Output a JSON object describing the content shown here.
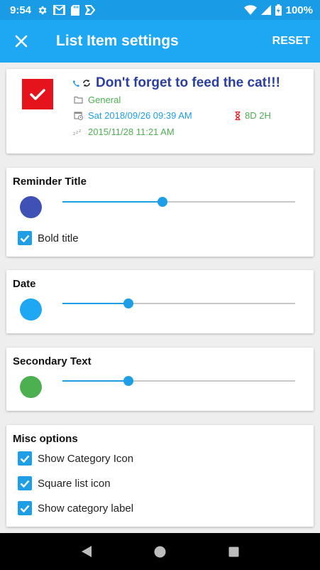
{
  "status_bar": {
    "time": "9:54",
    "battery": "100%",
    "icons": [
      "gear-icon",
      "gmail-icon",
      "sd-card-icon",
      "app-notification-icon",
      "wifi-icon",
      "signal-icon",
      "battery-charging-icon"
    ]
  },
  "app_bar": {
    "title": "List Item settings",
    "reset_label": "RESET"
  },
  "preview": {
    "title": "Don't forget to feed the cat!!!",
    "category": "General",
    "due_date": "Sat 2018/09/26 09:39 AM",
    "countdown": "8D 2H",
    "created": "2015/11/28 11:21 AM",
    "colors": {
      "icon_bg": "#e5131b",
      "title": "#2a3fa0",
      "date": "#1e9ee6",
      "secondary": "#4caf50"
    }
  },
  "reminder_title": {
    "label": "Reminder Title",
    "color": "#3f51b5",
    "slider_value": 0.43,
    "bold_label": "Bold title",
    "bold_checked": true
  },
  "date": {
    "label": "Date",
    "color": "#1ea7f3",
    "slider_value": 0.285
  },
  "secondary_text": {
    "label": "Secondary Text",
    "color": "#4caf50",
    "slider_value": 0.285
  },
  "misc": {
    "label": "Misc options",
    "options": [
      {
        "label": "Show Category Icon",
        "checked": true
      },
      {
        "label": "Square list icon",
        "checked": true
      },
      {
        "label": "Show category label",
        "checked": true
      }
    ]
  },
  "accent_color": "#1e9ee6"
}
